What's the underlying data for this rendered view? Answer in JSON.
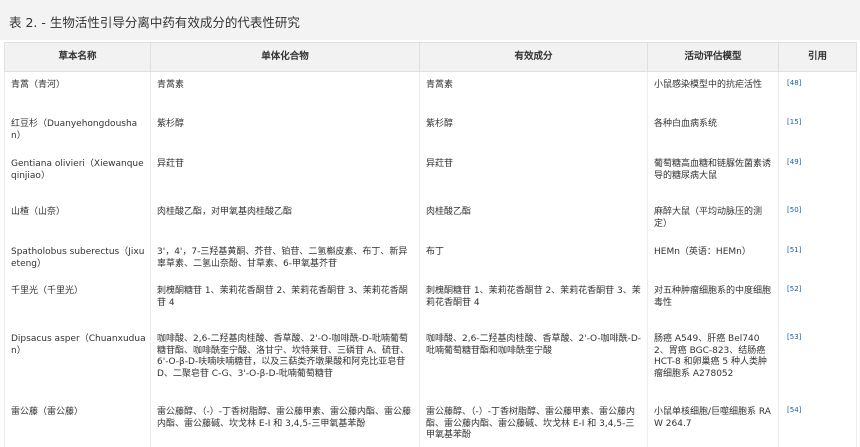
{
  "caption": "表 2. - 生物活性引导分离中药有效成分的代表性研究",
  "table": {
    "headers": [
      "草本名称",
      "单体化合物",
      "有效成分",
      "活动评估模型",
      "引用"
    ],
    "rows": [
      {
        "herb": "青蒿（青河）",
        "compounds": "青蒿素",
        "active": "青蒿素",
        "model": "小鼠感染模型中的抗疟活性",
        "citation": "48"
      },
      {
        "herb": "红豆杉（Duanyehongdoushan）",
        "compounds": "紫杉醇",
        "active": "紫杉醇",
        "model": "各种白血病系统",
        "citation": "15"
      },
      {
        "herb": "Gentiana olivieri（Xiewanqueqinjiao）",
        "compounds": "异荭苷",
        "active": "异荭苷",
        "model": "葡萄糖高血糖和链脲佐菌素诱导的糖尿病大鼠",
        "citation": "49"
      },
      {
        "herb": "山楂（山奈）",
        "compounds": "肉桂酸乙酯，对甲氧基肉桂酸乙酯",
        "active": "肉桂酸乙酯",
        "model": "麻醉大鼠（平均动脉压的测定）",
        "citation": "50"
      },
      {
        "herb": "Spatholobus suberectus（Jixueteng）",
        "compounds": "3'，4'，7-三羟基黄酮、芥苷、铂苷、二氢槲皮素、布丁、新异辜草素、二氢山奈酚、甘草素、6-甲氧基芥苷",
        "active": "布丁",
        "model": "HEMn（英语：HEMn）",
        "citation": "51"
      },
      {
        "herb": "千里光（千里光）",
        "compounds": "刺槐酮糖苷 1、茉莉花香酮苷 2、茉莉花香酮苷 3、茉莉花香酮苷 4",
        "active": "刺槐酮糖苷 1、茉莉花香酮苷 2、茉莉花香酮苷 3、茉莉花香酮苷 4",
        "model": "对五种肿瘤细胞系的中度细胞毒性",
        "citation": "52"
      },
      {
        "herb": "Dipsacus asper（Chuanxuduan）",
        "compounds": "咖啡酸、2,6-二羟基肉桂酸、香草酸、2'-O-咖啡酰-D-吡喃葡萄糖苷酯、咖啡酰奎宁酸、洛甘宁、坎特莱苷、三磷苷 A、硫苷、6'-O-β-D-呋喃呋喃糖苷，以及三萜类齐墩果酸和阿克比亚皂苷 D、二聚皂苷 C-G、3'-O-β-D-吡喃葡萄糖苷",
        "active": "咖啡酸、2,6-二羟基肉桂酸、香草酸、2'-O-咖啡酰-D-吡喃葡萄糖苷酯和咖啡酰奎宁酸",
        "model": "肠癌 A549、肝癌 Bel7402、胃癌 BGC-823、结肠癌 HCT-8 和卵巢癌 5 种人类肿瘤细胞系 A278052",
        "citation": "53"
      },
      {
        "herb": "雷公藤（雷公藤）",
        "compounds": "雷公藤醇、（-）-丁香树脂醇、雷公藤甲素、雷公藤内酯、雷公藤内酯、雷公藤碱、坎戈林 E-I 和 3,4,5-三甲氧基苯酚",
        "active": "雷公藤醇、（-）-丁香树脂醇、雷公藤甲素、雷公藤内酯、雷公藤内酯、雷公藤碱、坎戈林 E-I 和 3,4,5-三甲氧基苯酚",
        "model": "小鼠单核细胞/巨噬细胞系 RAW 264.7",
        "citation": "54"
      }
    ]
  }
}
